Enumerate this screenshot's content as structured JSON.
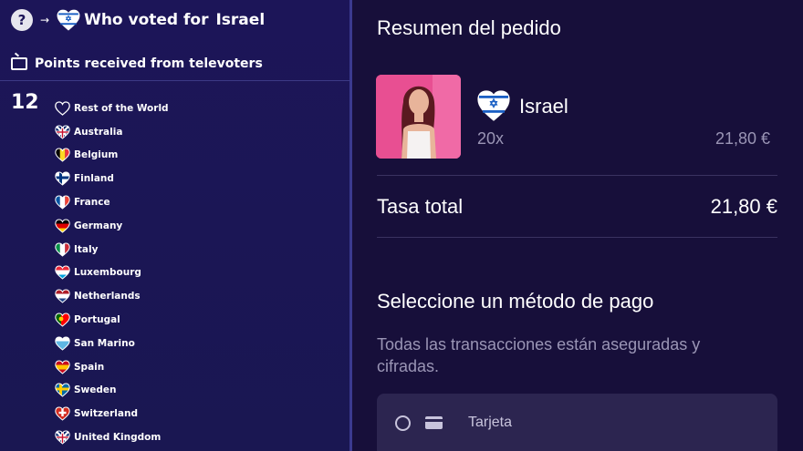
{
  "left": {
    "title_prefix": "Who voted for",
    "title_country": "Israel",
    "subtitle": "Points received from televoters",
    "points": "12",
    "voters": [
      {
        "name": "Rest of the World",
        "icon": "outline-heart-icon"
      },
      {
        "name": "Australia",
        "icon": "australia-flag-heart-icon"
      },
      {
        "name": "Belgium",
        "icon": "belgium-flag-heart-icon"
      },
      {
        "name": "Finland",
        "icon": "finland-flag-heart-icon"
      },
      {
        "name": "France",
        "icon": "france-flag-heart-icon"
      },
      {
        "name": "Germany",
        "icon": "germany-flag-heart-icon"
      },
      {
        "name": "Italy",
        "icon": "italy-flag-heart-icon"
      },
      {
        "name": "Luxembourg",
        "icon": "luxembourg-flag-heart-icon"
      },
      {
        "name": "Netherlands",
        "icon": "netherlands-flag-heart-icon"
      },
      {
        "name": "Portugal",
        "icon": "portugal-flag-heart-icon"
      },
      {
        "name": "San Marino",
        "icon": "san-marino-flag-heart-icon"
      },
      {
        "name": "Spain",
        "icon": "spain-flag-heart-icon"
      },
      {
        "name": "Sweden",
        "icon": "sweden-flag-heart-icon"
      },
      {
        "name": "Switzerland",
        "icon": "switzerland-flag-heart-icon"
      },
      {
        "name": "United Kingdom",
        "icon": "uk-flag-heart-icon"
      }
    ],
    "colors": {
      "bg": "#1c1558",
      "divider": "#3b3a8f"
    }
  },
  "right": {
    "title": "Resumen del pedido",
    "item_name": "Israel",
    "item_qty": "20x",
    "item_price": "21,80 €",
    "total_label": "Tasa total",
    "total_value": "21,80 €",
    "payment_heading": "Seleccione un método de pago",
    "payment_desc": "Todas las transacciones están aseguradas y cifradas.",
    "card_label": "Tarjeta",
    "colors": {
      "bg": "#170f3a",
      "muted": "#9a95b5",
      "card": "#2c2550"
    }
  }
}
